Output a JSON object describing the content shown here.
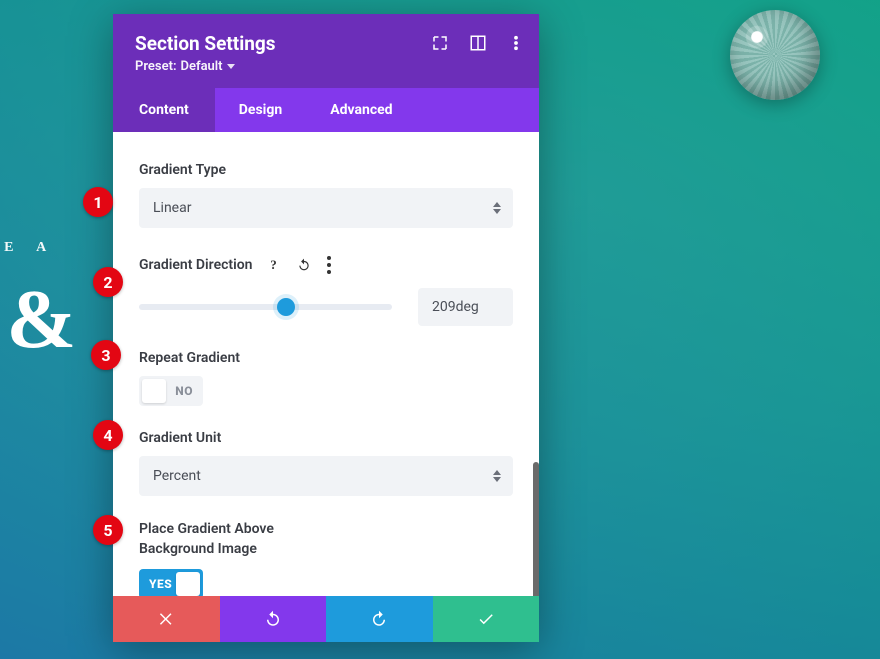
{
  "bg": {
    "tagline": "OME A",
    "headline": "l &"
  },
  "header": {
    "title": "Section Settings",
    "preset_prefix": "Preset:",
    "preset_value": "Default"
  },
  "tabs": [
    {
      "label": "Content",
      "active": true
    },
    {
      "label": "Design",
      "active": false
    },
    {
      "label": "Advanced",
      "active": false
    }
  ],
  "fields": {
    "gradient_type": {
      "label": "Gradient Type",
      "value": "Linear"
    },
    "gradient_direction": {
      "label": "Gradient Direction",
      "value": "209deg",
      "percent": 58
    },
    "repeat_gradient": {
      "label": "Repeat Gradient",
      "state": "NO"
    },
    "gradient_unit": {
      "label": "Gradient Unit",
      "value": "Percent"
    },
    "place_above": {
      "label_line1": "Place Gradient Above",
      "label_line2": "Background Image",
      "state": "YES"
    }
  },
  "annotations": [
    "1",
    "2",
    "3",
    "4",
    "5"
  ],
  "icons": {
    "expand": "expand-icon",
    "column": "column-layout-icon",
    "kebab": "kebab-menu-icon",
    "help": "help-icon",
    "undo_mini": "undo-icon",
    "kebab_mini": "kebab-menu-icon",
    "cancel": "close-icon",
    "undo": "undo-icon",
    "redo": "redo-icon",
    "save": "check-icon"
  }
}
